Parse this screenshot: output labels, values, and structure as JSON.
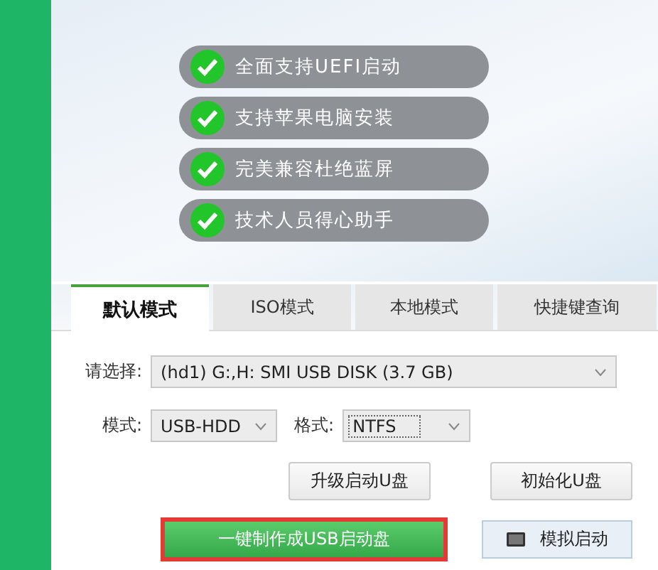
{
  "features": [
    {
      "label": "全面支持UEFI启动",
      "checked": true
    },
    {
      "label": "支持苹果电脑安装",
      "checked": true
    },
    {
      "label": "完美兼容杜绝蓝屏",
      "checked": true
    },
    {
      "label": "技术人员得心助手",
      "checked": true
    }
  ],
  "tabs": [
    {
      "label": "默认模式",
      "selected": true
    },
    {
      "label": "ISO模式",
      "selected": false
    },
    {
      "label": "本地模式",
      "selected": false
    },
    {
      "label": "快捷键查询",
      "selected": false
    }
  ],
  "device": {
    "label": "请选择:",
    "value": "(hd1) G:,H: SMI USB DISK (3.7 GB)"
  },
  "mode": {
    "label": "模式:",
    "value": "USB-HDD"
  },
  "format": {
    "label": "格式:",
    "value": "NTFS"
  },
  "buttons": [
    {
      "label": "升级启动U盘",
      "kind": "plain"
    },
    {
      "label": "初始化U盘",
      "kind": "plain"
    }
  ],
  "actions": [
    {
      "label": "一键制作成USB启动盘",
      "kind": "primary"
    },
    {
      "label": "模拟启动",
      "kind": "simulate"
    }
  ]
}
